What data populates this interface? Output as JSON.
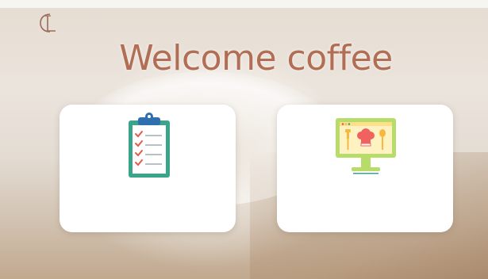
{
  "header": {
    "logo_icon": "cl-monogram-logo",
    "title": "Welcome coffee"
  },
  "cards": [
    {
      "icon": "clipboard-checklist-icon",
      "label": ""
    },
    {
      "icon": "monitor-menu-icon",
      "label": ""
    }
  ],
  "colors": {
    "title": "#b26e54",
    "card_background": "#ffffff",
    "clipboard_frame": "#3aa58a",
    "clipboard_clip": "#2f6fb0",
    "check_marks": "#e25b4b",
    "monitor_frame": "#b7dc6a",
    "monitor_screen": "#ffe08a",
    "chef_hat": "#f0625f"
  }
}
